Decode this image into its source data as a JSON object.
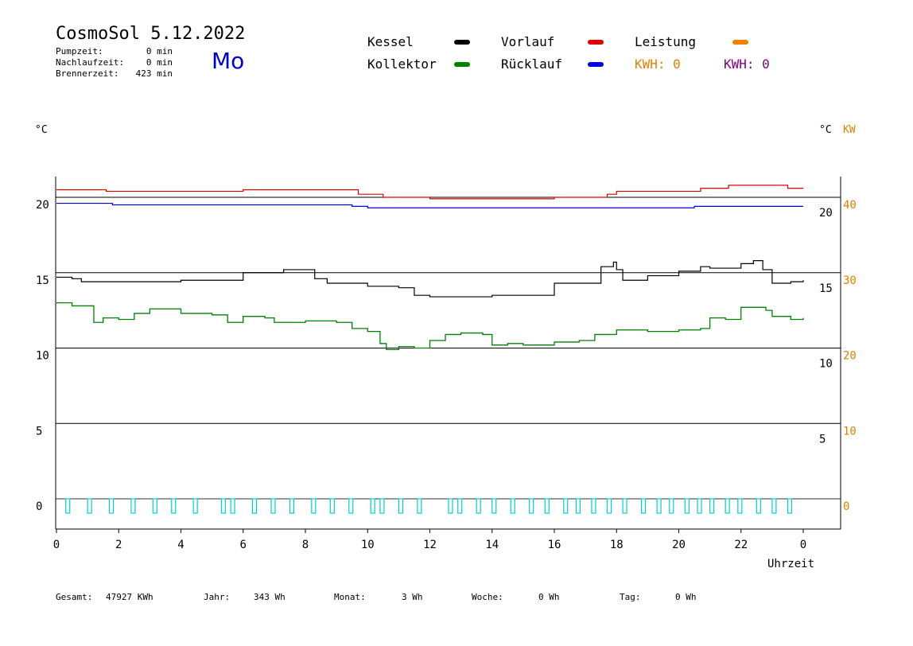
{
  "header": {
    "title": "CosmoSol 5.12.2022",
    "weekday": "Mo",
    "stats": [
      {
        "label": "Pumpzeit:",
        "value": "0 min"
      },
      {
        "label": "Nachlaufzeit:",
        "value": "0 min"
      },
      {
        "label": "Brennerzeit:",
        "value": "423 min"
      }
    ]
  },
  "legend": {
    "items": [
      {
        "label": "Kessel",
        "color": "#000000"
      },
      {
        "label": "Vorlauf",
        "color": "#e00000"
      },
      {
        "label": "Leistung",
        "color": "#f08000"
      },
      {
        "label": "Kollektor",
        "color": "#008000"
      },
      {
        "label": "Rücklauf",
        "color": "#0000e0"
      }
    ],
    "kwh": [
      {
        "label": "KWH: 0",
        "color": "#e08000"
      },
      {
        "label": "KWH: 0",
        "color": "#800080"
      }
    ]
  },
  "axes": {
    "left_unit": "°C",
    "right_unit": "°C",
    "right_unit2": "KW",
    "xlabel": "Uhrzeit"
  },
  "footer": [
    {
      "label": "Gesamt:",
      "value": "47927 KWh"
    },
    {
      "label": "Jahr:",
      "value": "343 Wh"
    },
    {
      "label": "Monat:",
      "value": "3 Wh"
    },
    {
      "label": "Woche:",
      "value": "0 Wh"
    },
    {
      "label": "Tag:",
      "value": "0 Wh"
    }
  ],
  "chart_data": {
    "type": "line",
    "x_ticks": [
      "0",
      "2",
      "4",
      "6",
      "8",
      "10",
      "12",
      "14",
      "16",
      "18",
      "20",
      "22",
      "0"
    ],
    "x_range": [
      0,
      24
    ],
    "y_left_ticks": [
      "20",
      "15",
      "10",
      "5",
      "0"
    ],
    "y_right_ticks": [
      "20",
      "15",
      "10",
      "5"
    ],
    "y_right2_ticks": [
      "40",
      "30",
      "20",
      "10",
      "0"
    ],
    "ylim": [
      -1.5,
      22
    ],
    "grid_y": [
      0,
      5,
      10,
      15,
      20
    ],
    "series": [
      {
        "name": "Vorlauf",
        "color": "#e00000",
        "points": [
          [
            0,
            20.5
          ],
          [
            1.6,
            20.5
          ],
          [
            1.6,
            20.4
          ],
          [
            6,
            20.4
          ],
          [
            6,
            20.5
          ],
          [
            9.2,
            20.5
          ],
          [
            9.7,
            20.2
          ],
          [
            10.5,
            20.0
          ],
          [
            12,
            19.9
          ],
          [
            14,
            19.9
          ],
          [
            16,
            20.0
          ],
          [
            17.7,
            20.2
          ],
          [
            18,
            20.4
          ],
          [
            20.5,
            20.4
          ],
          [
            20.7,
            20.6
          ],
          [
            21.5,
            20.6
          ],
          [
            21.6,
            20.8
          ],
          [
            23.4,
            20.8
          ],
          [
            23.5,
            20.6
          ],
          [
            24,
            20.6
          ]
        ]
      },
      {
        "name": "Rücklauf",
        "color": "#0000e0",
        "points": [
          [
            0,
            19.6
          ],
          [
            1,
            19.6
          ],
          [
            1.8,
            19.5
          ],
          [
            8,
            19.5
          ],
          [
            9.5,
            19.4
          ],
          [
            10,
            19.3
          ],
          [
            11,
            19.3
          ],
          [
            14,
            19.3
          ],
          [
            18,
            19.3
          ],
          [
            20,
            19.3
          ],
          [
            20.5,
            19.4
          ],
          [
            22,
            19.4
          ],
          [
            23,
            19.4
          ],
          [
            23.6,
            19.4
          ],
          [
            24,
            19.4
          ]
        ]
      },
      {
        "name": "Kessel",
        "color": "#000000",
        "points": [
          [
            0,
            14.7
          ],
          [
            0.5,
            14.6
          ],
          [
            0.8,
            14.4
          ],
          [
            2,
            14.4
          ],
          [
            4,
            14.5
          ],
          [
            6,
            15.0
          ],
          [
            7.3,
            15.2
          ],
          [
            7.8,
            15.2
          ],
          [
            8.3,
            14.6
          ],
          [
            8.7,
            14.3
          ],
          [
            10,
            14.1
          ],
          [
            11,
            14.0
          ],
          [
            11.5,
            13.5
          ],
          [
            12,
            13.4
          ],
          [
            13,
            13.4
          ],
          [
            14,
            13.5
          ],
          [
            16,
            14.3
          ],
          [
            17.5,
            15.4
          ],
          [
            17.9,
            15.7
          ],
          [
            18,
            15.2
          ],
          [
            18.2,
            14.5
          ],
          [
            19,
            14.8
          ],
          [
            20,
            15.1
          ],
          [
            20.7,
            15.4
          ],
          [
            21,
            15.3
          ],
          [
            22,
            15.6
          ],
          [
            22.4,
            15.8
          ],
          [
            22.7,
            15.2
          ],
          [
            23,
            14.3
          ],
          [
            23.6,
            14.4
          ],
          [
            24,
            14.5
          ]
        ]
      },
      {
        "name": "Kollektor",
        "color": "#008000",
        "points": [
          [
            0,
            13.0
          ],
          [
            0.5,
            12.8
          ],
          [
            1,
            12.8
          ],
          [
            1.2,
            11.7
          ],
          [
            1.5,
            12.0
          ],
          [
            2,
            11.9
          ],
          [
            2.5,
            12.3
          ],
          [
            3,
            12.6
          ],
          [
            4,
            12.3
          ],
          [
            5,
            12.2
          ],
          [
            5.5,
            11.7
          ],
          [
            6,
            12.1
          ],
          [
            6.7,
            12.0
          ],
          [
            7,
            11.7
          ],
          [
            8,
            11.8
          ],
          [
            9,
            11.7
          ],
          [
            9.5,
            11.3
          ],
          [
            10,
            11.1
          ],
          [
            10.4,
            10.3
          ],
          [
            10.6,
            9.9
          ],
          [
            11,
            10.1
          ],
          [
            11.5,
            10.0
          ],
          [
            12,
            10.5
          ],
          [
            12.5,
            10.9
          ],
          [
            13,
            11.0
          ],
          [
            13.7,
            10.9
          ],
          [
            14,
            10.2
          ],
          [
            14.5,
            10.3
          ],
          [
            15,
            10.2
          ],
          [
            16,
            10.4
          ],
          [
            16.8,
            10.5
          ],
          [
            17.3,
            10.9
          ],
          [
            18,
            11.2
          ],
          [
            19,
            11.1
          ],
          [
            20,
            11.2
          ],
          [
            20.7,
            11.3
          ],
          [
            21,
            12.0
          ],
          [
            21.5,
            11.9
          ],
          [
            22,
            12.7
          ],
          [
            22.8,
            12.5
          ],
          [
            23,
            12.1
          ],
          [
            23.6,
            11.9
          ],
          [
            24,
            12.0
          ]
        ]
      }
    ],
    "pump_pulses": [
      0.3,
      1.0,
      1.7,
      2.4,
      3.1,
      3.7,
      4.4,
      5.3,
      5.6,
      6.3,
      6.9,
      7.5,
      8.2,
      8.8,
      9.4,
      10.1,
      10.4,
      11.0,
      11.6,
      12.6,
      12.9,
      13.5,
      14.0,
      14.6,
      15.2,
      15.7,
      16.3,
      16.7,
      17.2,
      17.7,
      18.2,
      18.8,
      19.3,
      19.7,
      20.2,
      20.6,
      21.0,
      21.5,
      21.9,
      22.5,
      23.0,
      23.5
    ]
  }
}
